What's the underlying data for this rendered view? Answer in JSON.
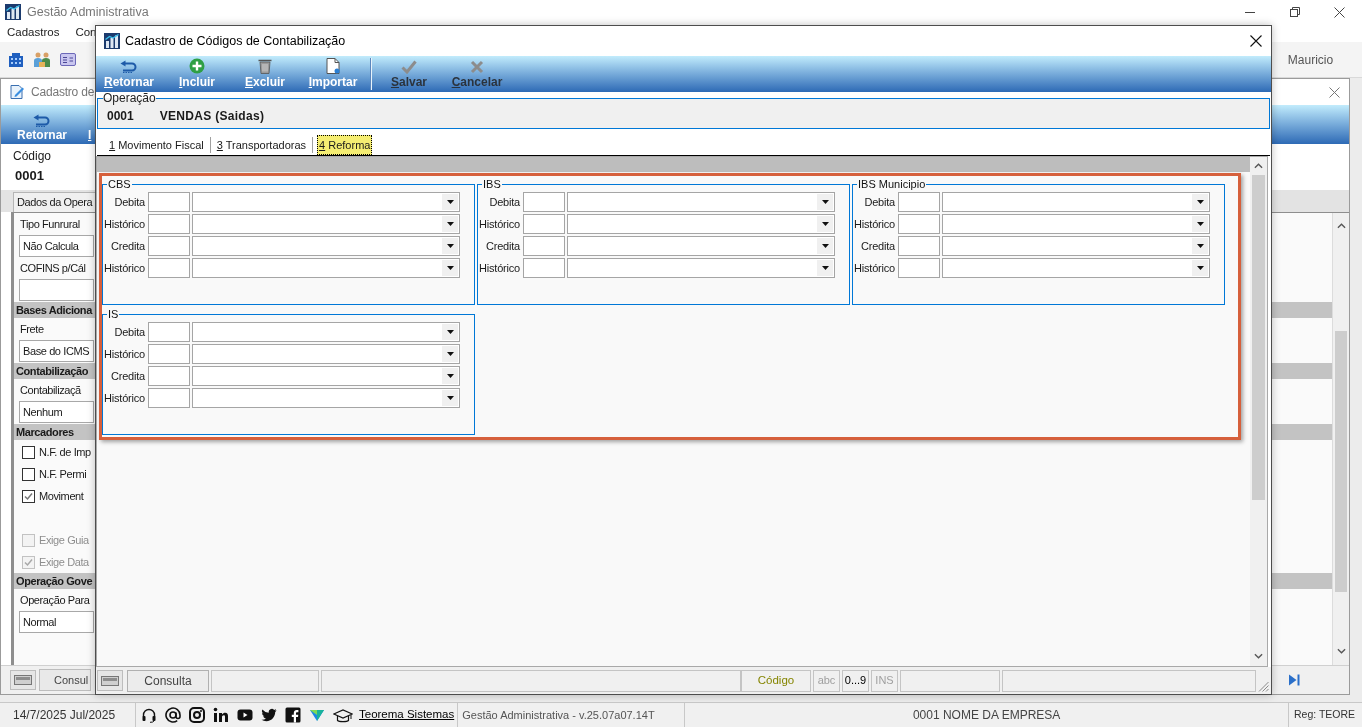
{
  "app_window": {
    "title": "Gestão Administrativa",
    "menu": [
      "Cadastros",
      "Con"
    ],
    "user": "Mauricio"
  },
  "background_window": {
    "title": "Cadastro de",
    "toolbar": [
      {
        "label": "Retornar",
        "kind": "return"
      },
      {
        "label": "I",
        "kind": "text"
      }
    ],
    "code_label": "Código",
    "code_value": "0001",
    "tab": "Dados da Opera",
    "form": [
      {
        "kind": "label",
        "text": "Tipo Funrural"
      },
      {
        "kind": "field",
        "value": "Não Calcula"
      },
      {
        "kind": "label",
        "text": "COFINS p/Cál"
      },
      {
        "kind": "field"
      },
      {
        "kind": "header",
        "text": "Bases Adiciona"
      },
      {
        "kind": "label",
        "text": "Frete"
      },
      {
        "kind": "field",
        "value": "Base do ICMS"
      },
      {
        "kind": "header",
        "text": "Contabilização"
      },
      {
        "kind": "label",
        "text": "Contabilizaçã"
      },
      {
        "kind": "field",
        "value": "Nenhum"
      },
      {
        "kind": "header",
        "text": "Marcadores"
      },
      {
        "kind": "checkbox",
        "label": "N.F. de Imp",
        "checked": false,
        "disabled": false
      },
      {
        "kind": "checkbox",
        "label": "N.F. Permi",
        "checked": false,
        "disabled": false
      },
      {
        "kind": "checkbox",
        "label": "Moviment",
        "checked": true,
        "disabled": false
      },
      {
        "kind": "checkbox",
        "label": "Exige Guia",
        "checked": false,
        "disabled": true
      },
      {
        "kind": "checkbox",
        "label": "Exige Data",
        "checked": true,
        "disabled": true
      },
      {
        "kind": "header",
        "text": "Operação Gove"
      },
      {
        "kind": "label",
        "text": "Operação Para"
      },
      {
        "kind": "field",
        "value": "Normal"
      }
    ],
    "bottom_tab": "Consul"
  },
  "dialog": {
    "title": "Cadastro de Códigos de Contabilização",
    "toolbar_groups": [
      [
        {
          "label": "Retornar",
          "kind": "return",
          "disabled": false
        },
        {
          "label": "Incluir",
          "kind": "add",
          "disabled": false
        },
        {
          "label": "Excluir",
          "kind": "delete",
          "disabled": false
        },
        {
          "label": "Importar",
          "kind": "import",
          "disabled": false
        }
      ],
      [
        {
          "label": "Salvar",
          "kind": "save",
          "disabled": true
        },
        {
          "label": "Cancelar",
          "kind": "cancel",
          "disabled": true
        }
      ]
    ],
    "operation": {
      "legend": "Operação",
      "code": "0001",
      "name": "VENDAS (Saidas)"
    },
    "tabs": [
      {
        "label": "1 Movimento Fiscal",
        "selected": false
      },
      {
        "label": "3 Transportadoras",
        "selected": false
      },
      {
        "label": "4 Reforma",
        "selected": true
      }
    ],
    "groups": [
      {
        "title": "CBS",
        "rows": [
          {
            "label": "Debita"
          },
          {
            "label": "Histórico"
          },
          {
            "label": "Credita"
          },
          {
            "label": "Histórico"
          }
        ]
      },
      {
        "title": "IBS",
        "rows": [
          {
            "label": "Debita"
          },
          {
            "label": "Histórico"
          },
          {
            "label": "Credita"
          },
          {
            "label": "Histórico"
          }
        ]
      },
      {
        "title": "IBS Municipio",
        "rows": [
          {
            "label": "Debita"
          },
          {
            "label": "Histórico"
          },
          {
            "label": "Credita"
          },
          {
            "label": "Histórico"
          }
        ]
      },
      {
        "title": "IS",
        "rows": [
          {
            "label": "Debita"
          },
          {
            "label": "Histórico"
          },
          {
            "label": "Credita"
          },
          {
            "label": "Histórico"
          }
        ]
      }
    ],
    "status": {
      "tab": "Consulta",
      "search_key": "Código",
      "indicators": [
        {
          "label": "abc",
          "active": false
        },
        {
          "label": "0...9",
          "active": true
        },
        {
          "label": "INS",
          "active": false
        }
      ]
    }
  },
  "status_bar": {
    "date": "14/7/2025 Jul/2025",
    "link": "Teorema Sistemas",
    "version": "Gestão Administrativa - v.25.07a07.14T",
    "company": "0001 NOME DA EMPRESA",
    "registration": "Reg: TEORE"
  }
}
